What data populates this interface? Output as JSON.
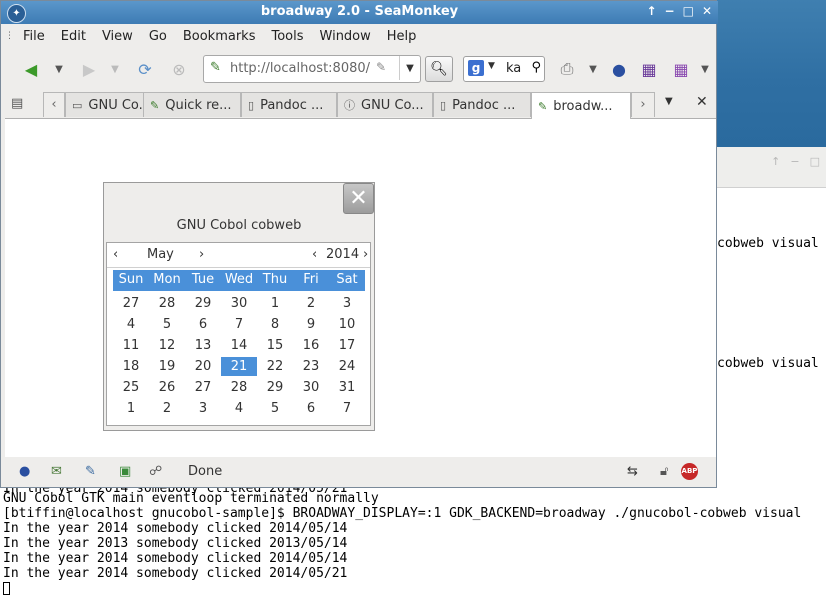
{
  "window": {
    "title": "broadway 2.0 - SeaMonkey",
    "controls": [
      "↑",
      "−",
      "□",
      "✕"
    ]
  },
  "menu": [
    "File",
    "Edit",
    "View",
    "Go",
    "Bookmarks",
    "Tools",
    "Window",
    "Help"
  ],
  "url": {
    "value": "http://localhost:8080/"
  },
  "search": {
    "engine_glyph": "g",
    "query": "ka"
  },
  "tabs": [
    {
      "label": "GNU Co...",
      "icon": "page-icon"
    },
    {
      "label": "Quick re...",
      "icon": "bookmark-icon"
    },
    {
      "label": "Pandoc ...",
      "icon": "doc-icon"
    },
    {
      "label": "GNU Co...",
      "icon": "info-icon"
    },
    {
      "label": "Pandoc ...",
      "icon": "doc-icon"
    },
    {
      "label": "broadw...",
      "icon": "bookmark-icon",
      "active": true
    }
  ],
  "status": {
    "text": "Done"
  },
  "dialog": {
    "title": "GNU Cobol cobweb",
    "month": "May",
    "year": "2014",
    "weekdays": [
      "Sun",
      "Mon",
      "Tue",
      "Wed",
      "Thu",
      "Fri",
      "Sat"
    ],
    "weeks": [
      [
        "27",
        "28",
        "29",
        "30",
        "1",
        "2",
        "3"
      ],
      [
        "4",
        "5",
        "6",
        "7",
        "8",
        "9",
        "10"
      ],
      [
        "11",
        "12",
        "13",
        "14",
        "15",
        "16",
        "17"
      ],
      [
        "18",
        "19",
        "20",
        "21",
        "22",
        "23",
        "24"
      ],
      [
        "25",
        "26",
        "27",
        "28",
        "29",
        "30",
        "31"
      ],
      [
        "1",
        "2",
        "3",
        "4",
        "5",
        "6",
        "7"
      ]
    ],
    "selected_day": "21"
  },
  "terminal": {
    "side_lines": [
      "cobweb visual",
      "cobweb visual"
    ],
    "lines": [
      "In the year 2014 somebody clicked 2014/05/21",
      "GNU Cobol GTK main eventloop terminated normally",
      "[btiffin@localhost gnucobol-sample]$ BROADWAY_DISPLAY=:1 GDK_BACKEND=broadway ./gnucobol-cobweb visual",
      "In the year 2014 somebody clicked 2014/05/14",
      "In the year 2013 somebody clicked 2013/05/14",
      "In the year 2014 somebody clicked 2014/05/14",
      "In the year 2014 somebody clicked 2014/05/21"
    ]
  },
  "colors": {
    "accent": "#4a90d9",
    "titlebar": "#3d7bb4"
  }
}
